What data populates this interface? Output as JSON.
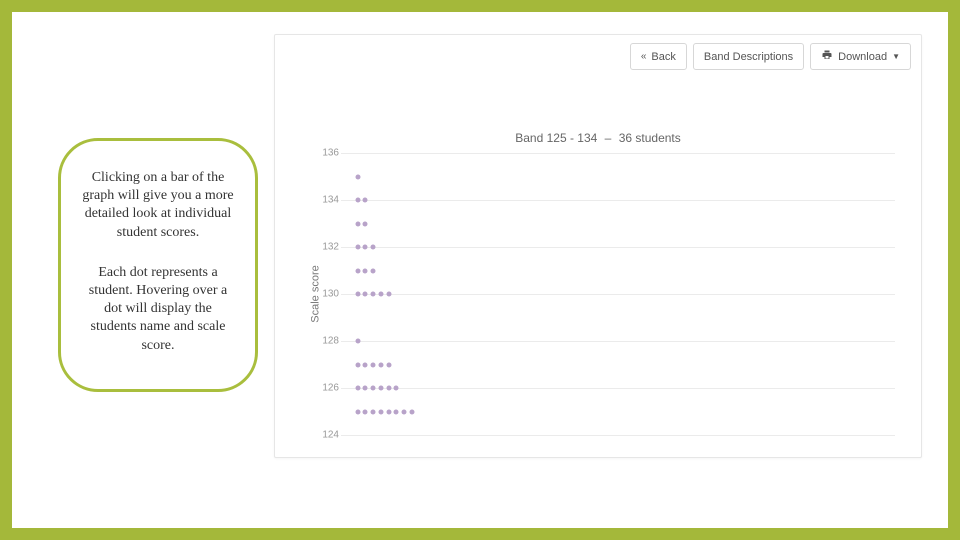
{
  "frame": {
    "accent": "#a4b83a"
  },
  "callout": {
    "para1": "Clicking on a bar of the graph will give you a more detailed look at individual student scores.",
    "para2": "Each dot represents a student. Hovering over a dot will display the students name and scale score."
  },
  "toolbar": {
    "back_label": "Back",
    "band_desc_label": "Band Descriptions",
    "download_label": "Download"
  },
  "chart_title": {
    "prefix": "Band 125 - 134",
    "suffix": "36 students"
  },
  "chart_data": {
    "type": "scatter",
    "ylabel": "Scale score",
    "ylim": [
      124,
      136
    ],
    "ticks": [
      124,
      126,
      128,
      130,
      132,
      134,
      136
    ],
    "rows": [
      {
        "y": 135,
        "count": 1
      },
      {
        "y": 134,
        "count": 2
      },
      {
        "y": 133,
        "count": 2
      },
      {
        "y": 132,
        "count": 3
      },
      {
        "y": 131,
        "count": 3
      },
      {
        "y": 130,
        "count": 5
      },
      {
        "y": 128,
        "count": 1
      },
      {
        "y": 127,
        "count": 5
      },
      {
        "y": 126,
        "count": 6
      },
      {
        "y": 125,
        "count": 8
      }
    ]
  }
}
